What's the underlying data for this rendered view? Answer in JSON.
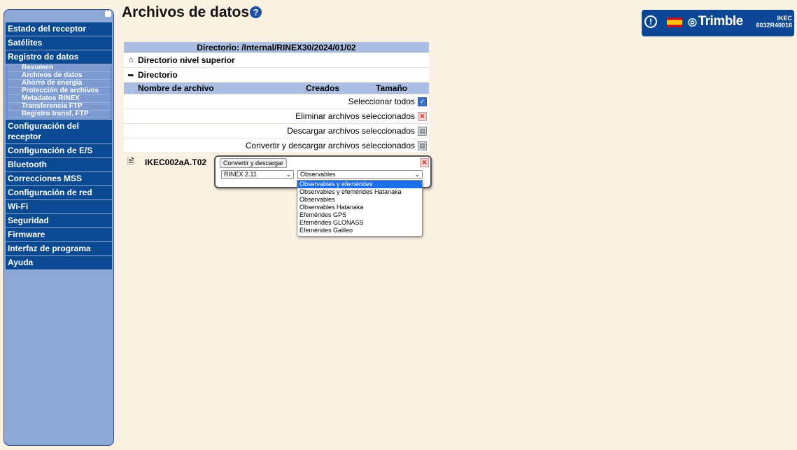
{
  "page": {
    "title": "Archivos de datos"
  },
  "header": {
    "alert_glyph": "!",
    "brand": "Trimble",
    "device_line1": "IKEC",
    "device_line2": "6032R40016"
  },
  "sidebar": {
    "items": [
      {
        "label": "Estado del receptor"
      },
      {
        "label": "Satélites"
      },
      {
        "label": "Registro de datos"
      },
      {
        "label": "Configuración del receptor"
      },
      {
        "label": "Configuración de E/S"
      },
      {
        "label": "Bluetooth"
      },
      {
        "label": "Correcciones MSS"
      },
      {
        "label": "Configuración de red"
      },
      {
        "label": "Wi-Fi"
      },
      {
        "label": "Seguridad"
      },
      {
        "label": "Firmware"
      },
      {
        "label": "Interfaz de programa"
      },
      {
        "label": "Ayuda"
      }
    ],
    "subitems": [
      {
        "label": "Resumen"
      },
      {
        "label": "Archivos de datos"
      },
      {
        "label": "Ahorro de energía"
      },
      {
        "label": "Protección de archivos"
      },
      {
        "label": "Metadatos RINEX"
      },
      {
        "label": "Transferencia FTP"
      },
      {
        "label": "Registro transf. FTP"
      }
    ]
  },
  "table": {
    "directory_header": "Directorio: /Internal/RINEX30/2024/01/02",
    "top_dir": "Directorio nivel superior",
    "dir": "Directorio",
    "col_name": "Nombre de archivo",
    "col_created": "Creados",
    "col_size": "Tamaño",
    "select_all": "Seleccionar todos",
    "delete_selected": "Eliminar archivos seleccionados",
    "download_selected": "Descargar archivos seleccionados",
    "convert_download_selected": "Convertir y descargar archivos seleccionados",
    "file_name": "IKEC002aA.T02"
  },
  "popup": {
    "button_label": "Convertir y descargar",
    "format_value": "RINEX 2.11",
    "type_value": "Observables",
    "options": [
      "Observables y efemérides",
      "Observables y efemérides Hatanaka",
      "Observables",
      "Observables Hatanaka",
      "Efemérides GPS",
      "Efemérides GLONASS",
      "Efemérides Galileo"
    ]
  },
  "colors": {
    "sidebar_item_bg": "#0a4a93",
    "table_header_bg": "#a9bee2",
    "page_bg": "#fbf1e3",
    "selected_option_bg": "#1e6fe6"
  }
}
